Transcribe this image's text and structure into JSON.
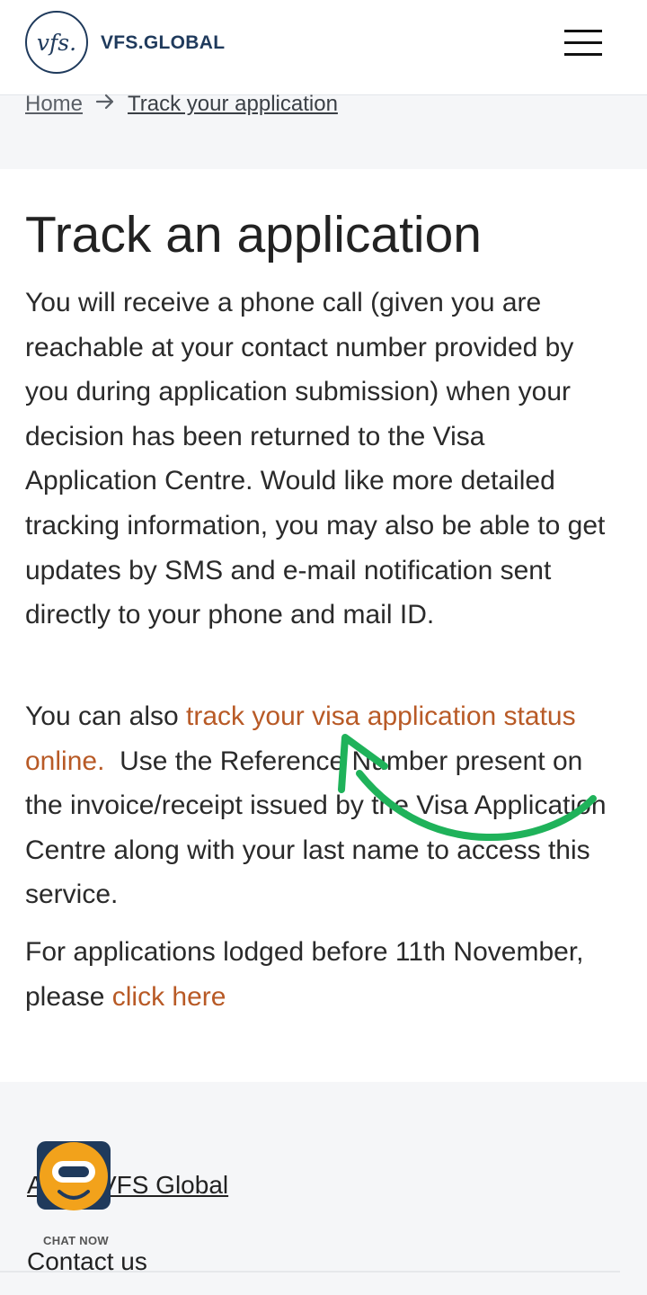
{
  "header": {
    "logo_mark": "vfs.",
    "logo_text": "VFS.GLOBAL"
  },
  "breadcrumb": {
    "home": "Home",
    "current": "Track your application"
  },
  "main": {
    "title": "Track an application",
    "para1": "You will receive a phone call (given you are reachable at your contact number provided by you during application submission) when your decision has been returned to the Visa Application Centre. Would like more detailed tracking information, you may also be able to get updates by SMS and e-mail notification sent directly to your phone and mail ID.",
    "para2_prefix": "You can also ",
    "para2_link": "track your visa application status online.",
    "para2_suffix": "  Use the Reference Number present on the invoice/receipt issued by the Visa Application Centre along with your last name to access this service.",
    "para3_prefix": "For applications lodged before 11th November, please ",
    "para3_link": "click here"
  },
  "footer": {
    "about": "About VFS Global",
    "contact": "Contact us"
  },
  "chat": {
    "label": "CHAT NOW"
  },
  "colors": {
    "brand_navy": "#1f3a5c",
    "link_orange": "#b85a26",
    "annotation_green": "#1fb25a",
    "chat_orange": "#f2a21b"
  }
}
